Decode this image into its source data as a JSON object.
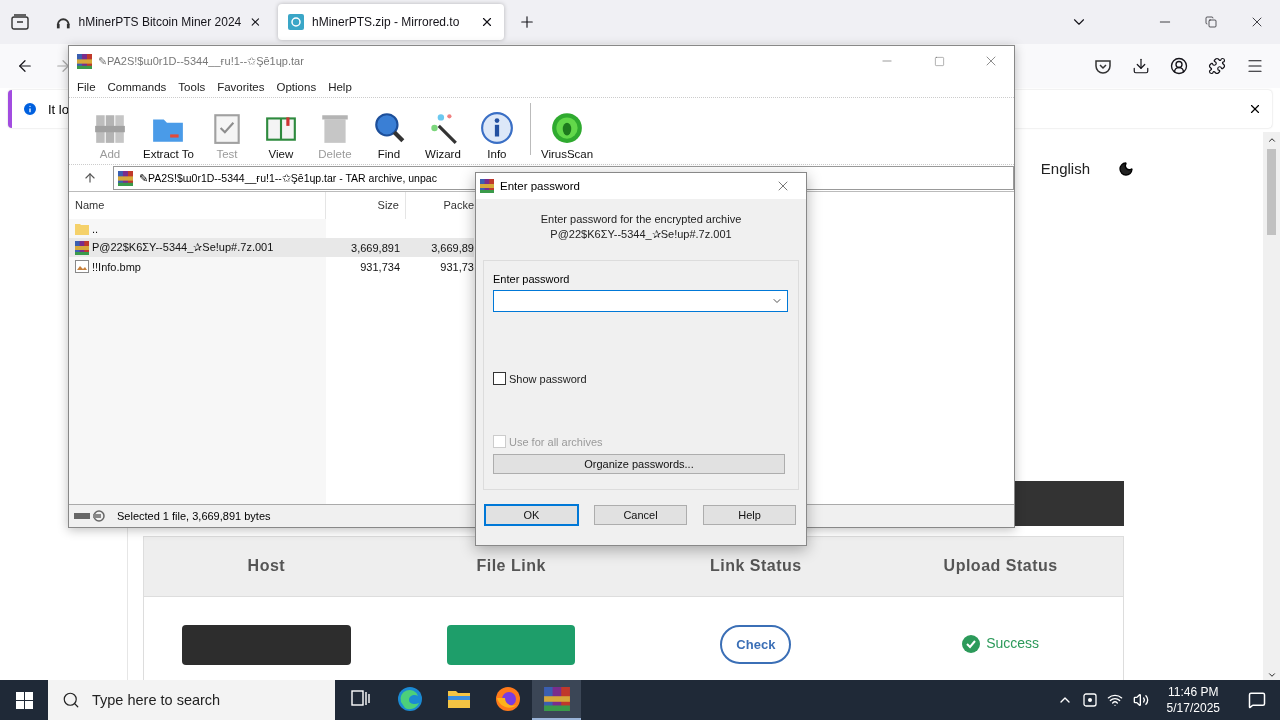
{
  "browser": {
    "tabs": [
      {
        "title": "hMinerPTS Bitcoin Miner 2024",
        "selected": false
      },
      {
        "title": "hMinerPTS.zip - Mirrored.to",
        "selected": true
      }
    ],
    "notification": {
      "text": "It lo"
    },
    "page": {
      "language": "English",
      "table": {
        "columns": [
          "Host",
          "File Link",
          "Link Status",
          "Upload Status"
        ],
        "row": {
          "check_button": "Check",
          "status": "Success"
        }
      }
    }
  },
  "winrar": {
    "title": "✎PA2S!$ɯ0r1D--5344__ғu!1--✩Şē1ɥp.tar",
    "menu": [
      "File",
      "Commands",
      "Tools",
      "Favorites",
      "Options",
      "Help"
    ],
    "toolbar": [
      {
        "label": "Add",
        "kind": "add",
        "disabled": true
      },
      {
        "label": "Extract To",
        "kind": "extract",
        "disabled": false
      },
      {
        "label": "Test",
        "kind": "test",
        "disabled": true
      },
      {
        "label": "View",
        "kind": "view",
        "disabled": false
      },
      {
        "label": "Delete",
        "kind": "delete",
        "disabled": true
      },
      {
        "label": "Find",
        "kind": "find",
        "disabled": false
      },
      {
        "label": "Wizard",
        "kind": "wizard",
        "disabled": false
      },
      {
        "label": "Info",
        "kind": "info",
        "disabled": false
      },
      {
        "label": "VirusScan",
        "kind": "virus",
        "disabled": false
      }
    ],
    "address": "✎PA2S!$ɯ0r1D--5344__ғu!1--✩Şē1ɥp.tar - TAR archive, unpac",
    "columns": [
      "Name",
      "Size",
      "Packe"
    ],
    "files": [
      {
        "name": "..",
        "kind": "folder",
        "selected": false
      },
      {
        "name": "P@22$K6ΣY--5344_✰Se!up#.7z.001",
        "kind": "archive",
        "size": "3,669,891",
        "packed": "3,669,89",
        "selected": true
      },
      {
        "name": "!!Info.bmp",
        "kind": "image",
        "size": "931,734",
        "packed": "931,73",
        "selected": false
      }
    ],
    "status": "Selected 1 file, 3,669,891 bytes"
  },
  "dialog": {
    "title": "Enter password",
    "message": "Enter password for the encrypted archive",
    "archive": "P@22$K6ΣY--5344_✰Se!up#.7z.001",
    "field_label": "Enter password",
    "show_password": {
      "label": "Show password",
      "checked": false,
      "disabled": false
    },
    "use_for_all": {
      "label": "Use for all archives",
      "checked": false,
      "disabled": true
    },
    "organize": "Organize passwords...",
    "buttons": [
      {
        "label": "OK",
        "default": true
      },
      {
        "label": "Cancel",
        "default": false
      },
      {
        "label": "Help",
        "default": false
      }
    ]
  },
  "taskbar": {
    "search_placeholder": "Type here to search",
    "apps": [
      {
        "kind": "taskview",
        "active": false
      },
      {
        "kind": "edge",
        "active": false
      },
      {
        "kind": "explorer",
        "active": false
      },
      {
        "kind": "firefox",
        "active": false
      },
      {
        "kind": "winrar",
        "active": true
      }
    ],
    "time": "11:46 PM",
    "date": "5/17/2025"
  }
}
